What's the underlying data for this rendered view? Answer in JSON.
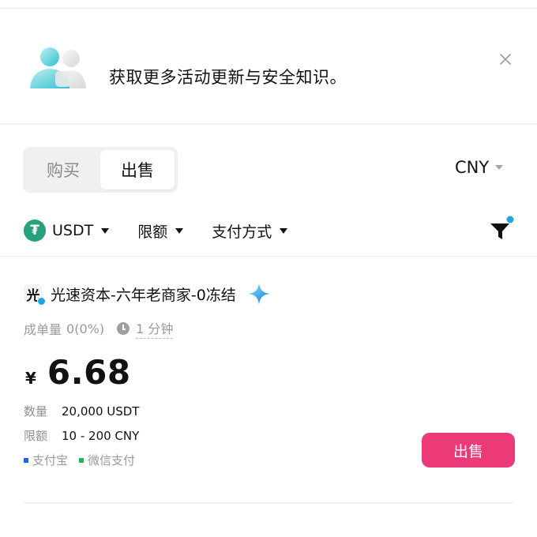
{
  "banner": {
    "text": "获取更多活动更新与安全知识。",
    "close_icon": "close-icon"
  },
  "tabs": {
    "buy_label": "购买",
    "sell_label": "出售",
    "active": "sell"
  },
  "currency": {
    "value": "CNY"
  },
  "filters": {
    "asset_label": "USDT",
    "asset_logo_glyph": "₮",
    "limit_label": "限额",
    "payment_label": "支付方式"
  },
  "ad": {
    "avatar_glyph": "光",
    "merchant_name": "光速资本-六年老商家-0冻结",
    "stats_label": "成单量",
    "stats_value": "0(0%)",
    "time_value": "1 分钟",
    "currency_symbol": "¥",
    "price": "6.68",
    "quantity_label": "数量",
    "quantity_value": "20,000 USDT",
    "limit_label": "限额",
    "limit_value": "10 - 200 CNY",
    "payment_methods": [
      {
        "label": "支付宝",
        "color": "#1b67e0"
      },
      {
        "label": "微信支付",
        "color": "#22b35e"
      }
    ],
    "sell_button": "出售"
  },
  "colors": {
    "accent_pink": "#ec3a78",
    "tether_green": "#26a17b",
    "filter_badge": "#22a6e0"
  }
}
